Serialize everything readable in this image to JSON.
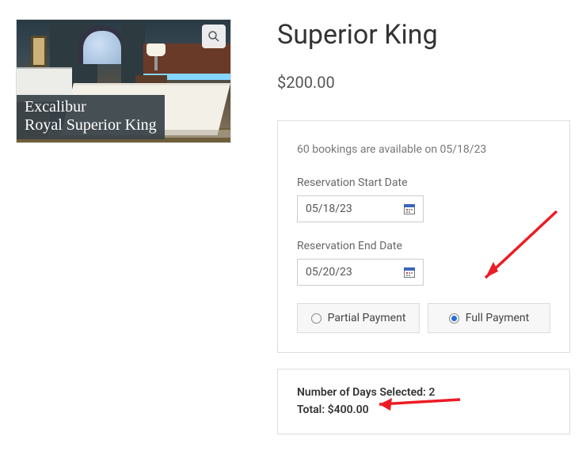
{
  "image": {
    "caption_line1": "Excalibur",
    "caption_line2": "Royal Superior King"
  },
  "product": {
    "title": "Superior King",
    "price": "$200.00"
  },
  "booking": {
    "availability_text": "60 bookings are available on 05/18/23",
    "start_label": "Reservation Start Date",
    "start_value": "05/18/23",
    "end_label": "Reservation End Date",
    "end_value": "05/20/23",
    "partial_label": "Partial Payment",
    "full_label": "Full Payment"
  },
  "summary": {
    "days_label": "Number of Days Selected:",
    "days_value": "2",
    "total_label": "Total:",
    "total_value": "$400.00"
  }
}
